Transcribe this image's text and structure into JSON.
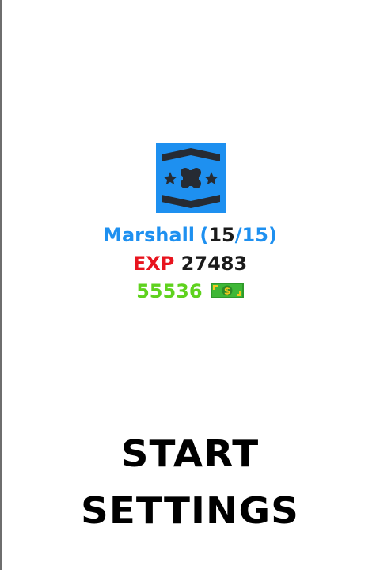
{
  "player": {
    "rank_name": "Marshall",
    "rank_open": "(",
    "rank_level": "15",
    "rank_sep": "/",
    "rank_max": "15",
    "rank_close": ")",
    "exp_label": "EXP",
    "exp_value": "27483",
    "money": "55536"
  },
  "menu": {
    "start_label": "START",
    "settings_label": "SETTINGS"
  },
  "icons": {
    "rank_badge": "marshall-rank-badge-icon",
    "currency": "cash-icon"
  },
  "colors": {
    "background": "#ffffff",
    "rank_blue": "#1e90f0",
    "exp_red": "#e8141e",
    "money_green": "#5fd21e",
    "text_dark": "#1a1a1a",
    "badge_bg": "#1e90f0",
    "badge_dark": "#262b33"
  }
}
